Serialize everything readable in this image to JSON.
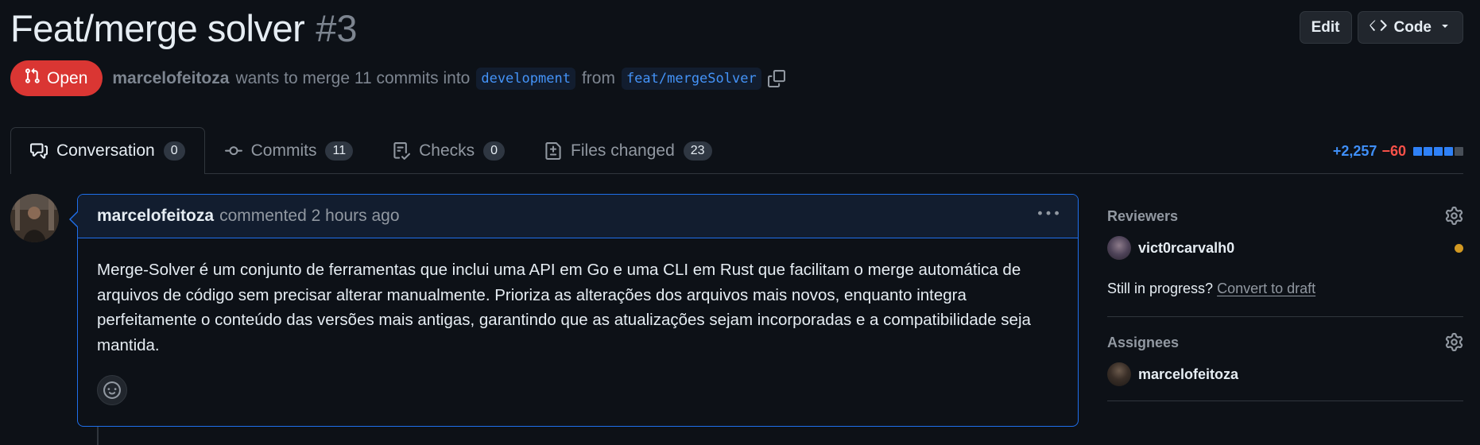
{
  "pr": {
    "title": "Feat/merge solver",
    "number": "#3",
    "state": "Open",
    "author": "marcelofeitoza",
    "merge_text": "wants to merge 11 commits into",
    "base_branch": "development",
    "from_text": "from",
    "head_branch": "feat/mergeSolver"
  },
  "header_actions": {
    "edit_label": "Edit",
    "code_label": "Code"
  },
  "tabs": [
    {
      "label": "Conversation",
      "count": "0",
      "icon": "comment-discussion-icon"
    },
    {
      "label": "Commits",
      "count": "11",
      "icon": "git-commit-icon"
    },
    {
      "label": "Checks",
      "count": "0",
      "icon": "checklist-icon"
    },
    {
      "label": "Files changed",
      "count": "23",
      "icon": "file-diff-icon"
    }
  ],
  "diffstat": {
    "additions": "+2,257",
    "deletions": "−60",
    "blocks": [
      "#2f81f7",
      "#2f81f7",
      "#2f81f7",
      "#2f81f7",
      "#484f58"
    ]
  },
  "comment": {
    "author": "marcelofeitoza",
    "action": "commented",
    "time": "2 hours ago",
    "body": "Merge-Solver é um conjunto de ferramentas que inclui uma API em Go e uma CLI em Rust que facilitam o merge automática de arquivos de código sem precisar alterar manualmente. Prioriza as alterações dos arquivos mais novos, enquanto integra perfeitamente o conteúdo das versões mais antigas, garantindo que as atualizações sejam incorporadas e a compatibilidade seja mantida."
  },
  "sidebar": {
    "reviewers_title": "Reviewers",
    "reviewer": "vict0rcarvalh0",
    "draft_prompt": "Still in progress?",
    "draft_link": "Convert to draft",
    "assignees_title": "Assignees",
    "assignee": "marcelofeitoza"
  },
  "colors": {
    "background": "#0d1117",
    "open_badge": "#da3633",
    "accent_blue": "#1f6feb",
    "link_blue": "#4493f8",
    "pending_dot": "#d29922"
  }
}
